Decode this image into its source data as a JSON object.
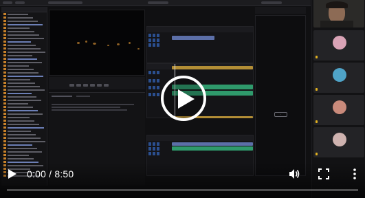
{
  "player": {
    "current_time": "0:00",
    "separator": "/",
    "duration": "8:50",
    "progress": 0,
    "accent_color": "#ff0000",
    "icons": {
      "big_play": "play-icon",
      "play": "play-icon",
      "volume": "volume-icon",
      "fullscreen": "fullscreen-icon",
      "more": "more-vertical-icon"
    }
  },
  "editor": {
    "inspector_badge": "-",
    "clip_colors": {
      "video": "#b38e36",
      "audio": "#2f9a6c",
      "selected": "#5c6fa8"
    }
  },
  "participants": {
    "tiles": [
      {
        "avatar_color": "#d9a3b6"
      },
      {
        "avatar_color": "#4fa3c7"
      },
      {
        "avatar_color": "#c98a7b"
      },
      {
        "avatar_color": "#cfb3b0"
      }
    ]
  }
}
